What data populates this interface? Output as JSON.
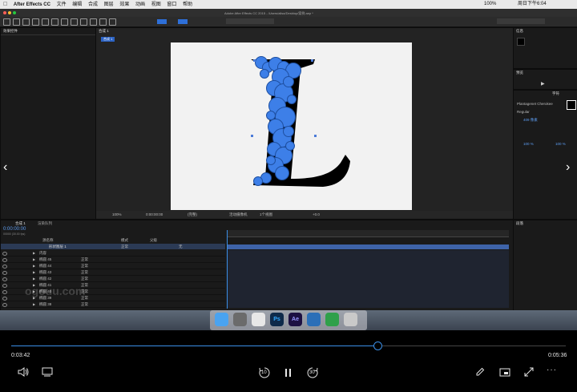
{
  "menubar": {
    "app": "After Effects CC",
    "items": [
      "文件",
      "编辑",
      "合成",
      "图层",
      "效果",
      "动画",
      "视图",
      "窗口",
      "帮助"
    ],
    "status": "100%",
    "clock": "周日下午6:04"
  },
  "window_title": "Adobe After Effects CC 2015 - /Users/alisa/Desktop/案例.aep *",
  "left_panel": {
    "tab": "效果控件"
  },
  "comp_panel": {
    "tab": "合成 1",
    "chip": "合成 1",
    "footer": {
      "zoom": "100%",
      "time": "0:00:00:00",
      "quality": "(完整)",
      "camera": "活动摄像机",
      "views": "1个视图",
      "offset": "+0.0"
    }
  },
  "right_panel": {
    "info_tab": "信息",
    "preview_tab": "预览",
    "char_tab": "字符",
    "font": "Plantagenet Cherokee",
    "style": "Regular",
    "size": "409 像素",
    "scale_v": "100 %",
    "scale_h": "100 %",
    "align_tab": "段落"
  },
  "timeline": {
    "tab": "合成 1",
    "render_tab": "渲染队列",
    "timecode": "0:00:00:00",
    "fps": "00000 (30.00 fps)",
    "col_source": "源名称",
    "col_mode": "模式",
    "col_parent": "父级",
    "layer_top": "形状图层 1",
    "rows": [
      {
        "name": "内容",
        "mode": ""
      },
      {
        "name": "椭圆 45",
        "mode": "正常"
      },
      {
        "name": "椭圆 44",
        "mode": "正常"
      },
      {
        "name": "椭圆 43",
        "mode": "正常"
      },
      {
        "name": "椭圆 42",
        "mode": "正常"
      },
      {
        "name": "椭圆 41",
        "mode": "正常"
      },
      {
        "name": "椭圆 40",
        "mode": "正常"
      },
      {
        "name": "椭圆 39",
        "mode": "正常"
      },
      {
        "name": "椭圆 38",
        "mode": "正常"
      }
    ],
    "parent_value": "无",
    "mode_value": "正常",
    "watermark": "ogouu.com"
  },
  "dock": {
    "icons": [
      {
        "name": "finder-icon",
        "label": "",
        "color": "#4aa3f0"
      },
      {
        "name": "launchpad-icon",
        "label": "",
        "color": "#6b6b6b"
      },
      {
        "name": "chrome-icon",
        "label": "",
        "color": "#e8e8e8"
      },
      {
        "name": "photoshop-icon",
        "label": "Ps",
        "color": "#0e2a4a"
      },
      {
        "name": "after-effects-icon",
        "label": "Ae",
        "color": "#1c1042"
      },
      {
        "name": "quicktime-icon",
        "label": "",
        "color": "#2b6fb8"
      },
      {
        "name": "evernote-icon",
        "label": "",
        "color": "#2fa04a"
      },
      {
        "name": "trash-icon",
        "label": "",
        "color": "#c9c9c9"
      }
    ]
  },
  "player": {
    "current_time": "0:03:42",
    "total_time": "0:05:36",
    "progress": 0.66,
    "rewind_label": "10",
    "forward_label": "30",
    "accent": "#3a8ee6"
  }
}
